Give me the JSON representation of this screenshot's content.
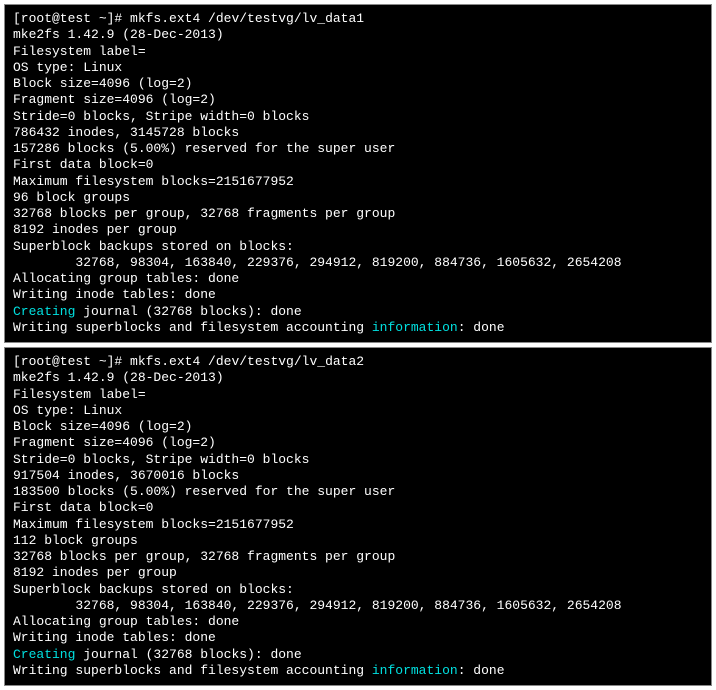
{
  "term1": {
    "prompt": "[root@test ~]# ",
    "cmd": "mkfs.ext4 /dev/testvg/lv_data1",
    "l1": "mke2fs 1.42.9 (28-Dec-2013)",
    "l2": "Filesystem label=",
    "l3": "OS type: Linux",
    "l4": "Block size=4096 (log=2)",
    "l5": "Fragment size=4096 (log=2)",
    "l6": "Stride=0 blocks, Stripe width=0 blocks",
    "l7": "786432 inodes, 3145728 blocks",
    "l8": "157286 blocks (5.00%) reserved for the super user",
    "l9": "First data block=0",
    "l10": "Maximum filesystem blocks=2151677952",
    "l11": "96 block groups",
    "l12": "32768 blocks per group, 32768 fragments per group",
    "l13": "8192 inodes per group",
    "l14": "Superblock backups stored on blocks:",
    "l15": "        32768, 98304, 163840, 229376, 294912, 819200, 884736, 1605632, 2654208",
    "blank": "",
    "l16": "Allocating group tables: done",
    "l17": "Writing inode tables: done",
    "l18a": "Creating",
    "l18b": " journal (32768 blocks): done",
    "l19a": "Writing superblocks and filesystem accounting ",
    "l19b": "information",
    "l19c": ": done"
  },
  "term2": {
    "prompt": "[root@test ~]# ",
    "cmd": "mkfs.ext4 /dev/testvg/lv_data2",
    "l1": "mke2fs 1.42.9 (28-Dec-2013)",
    "l2": "Filesystem label=",
    "l3": "OS type: Linux",
    "l4": "Block size=4096 (log=2)",
    "l5": "Fragment size=4096 (log=2)",
    "l6": "Stride=0 blocks, Stripe width=0 blocks",
    "l7": "917504 inodes, 3670016 blocks",
    "l8": "183500 blocks (5.00%) reserved for the super user",
    "l9": "First data block=0",
    "l10": "Maximum filesystem blocks=2151677952",
    "l11": "112 block groups",
    "l12": "32768 blocks per group, 32768 fragments per group",
    "l13": "8192 inodes per group",
    "l14": "Superblock backups stored on blocks:",
    "l15": "        32768, 98304, 163840, 229376, 294912, 819200, 884736, 1605632, 2654208",
    "blank": "",
    "l16": "Allocating group tables: done",
    "l17": "Writing inode tables: done",
    "l18a": "Creating",
    "l18b": " journal (32768 blocks): done",
    "l19a": "Writing superblocks and filesystem accounting ",
    "l19b": "information",
    "l19c": ": done"
  }
}
